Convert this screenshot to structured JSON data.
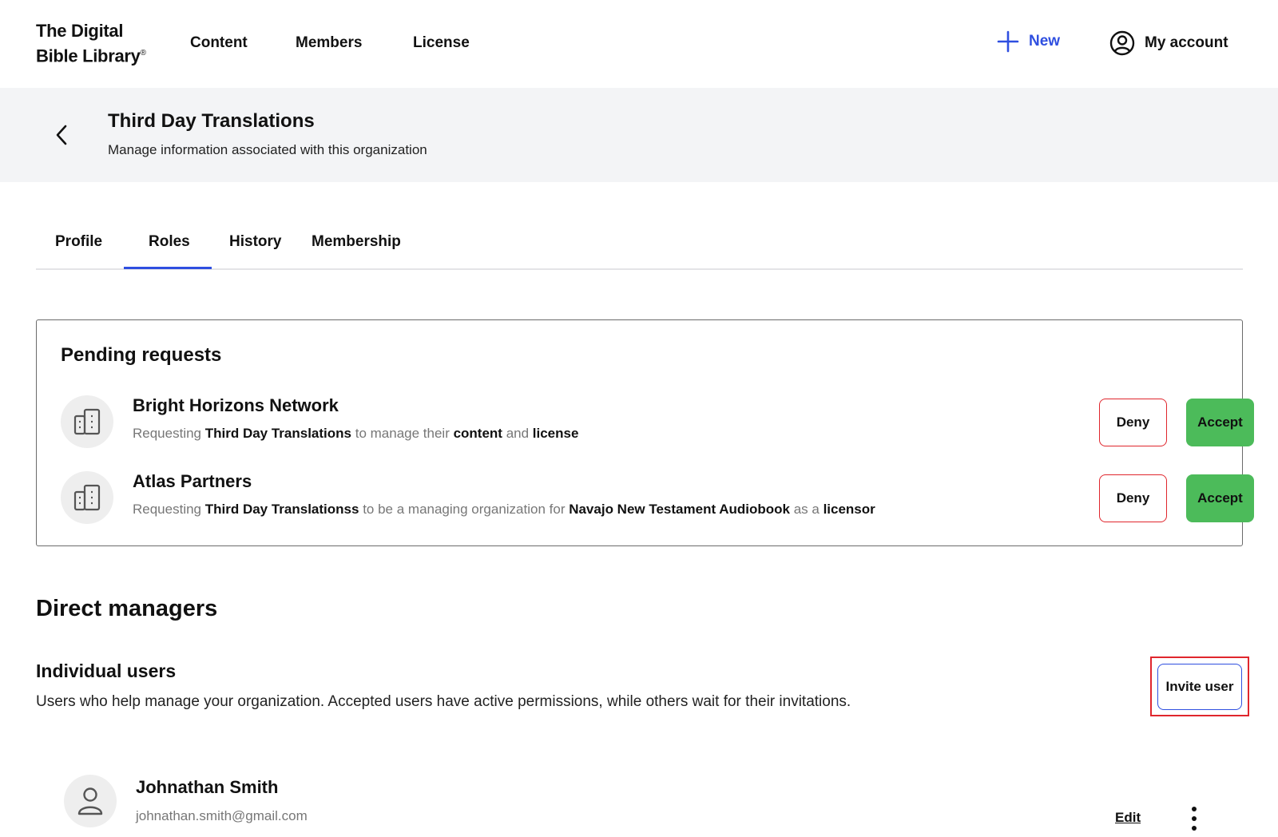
{
  "app": {
    "logo_line1": "The Digital",
    "logo_line2": "Bible Library",
    "logo_mark": "®"
  },
  "nav": {
    "items": [
      {
        "label": "Content"
      },
      {
        "label": "Members"
      },
      {
        "label": "License"
      }
    ],
    "new_label": "New",
    "account_label": "My account",
    "accent_color": "#2f4fe0"
  },
  "header": {
    "title": "Third Day Translations",
    "subtitle": "Manage information associated with this organization"
  },
  "tabs": [
    {
      "label": "Profile"
    },
    {
      "label": "Roles",
      "active": true
    },
    {
      "label": "History"
    },
    {
      "label": "Membership"
    }
  ],
  "pending": {
    "title": "Pending requests",
    "deny_label": "Deny",
    "accept_label": "Accept",
    "requests": [
      {
        "name": "Bright Horizons Network",
        "parts": [
          "Requesting ",
          "Third Day Translations",
          " to manage their ",
          "content",
          " and ",
          "license"
        ]
      },
      {
        "name": "Atlas Partners",
        "parts": [
          "Requesting ",
          "Third Day Translationss",
          " to be a managing organization for ",
          "Navajo New Testament Audiobook",
          " as a ",
          "licensor"
        ]
      }
    ],
    "deny_color": "#e0262d",
    "accept_color": "#4cbb5a"
  },
  "direct_managers": {
    "title": "Direct managers",
    "individual_users": {
      "title": "Individual users",
      "description": "Users who help manage your organization. Accepted users have active permissions, while others wait for their invitations.",
      "invite_label": "Invite user"
    },
    "users": [
      {
        "name": "Johnathan Smith",
        "email": "johnathan.smith@gmail.com",
        "edit_label": "Edit"
      }
    ]
  },
  "icons": {
    "new": "plus-icon",
    "account": "user-circle-icon",
    "back": "chevron-left-icon",
    "org": "building-icon",
    "user": "person-icon",
    "more": "more-vertical-icon"
  }
}
